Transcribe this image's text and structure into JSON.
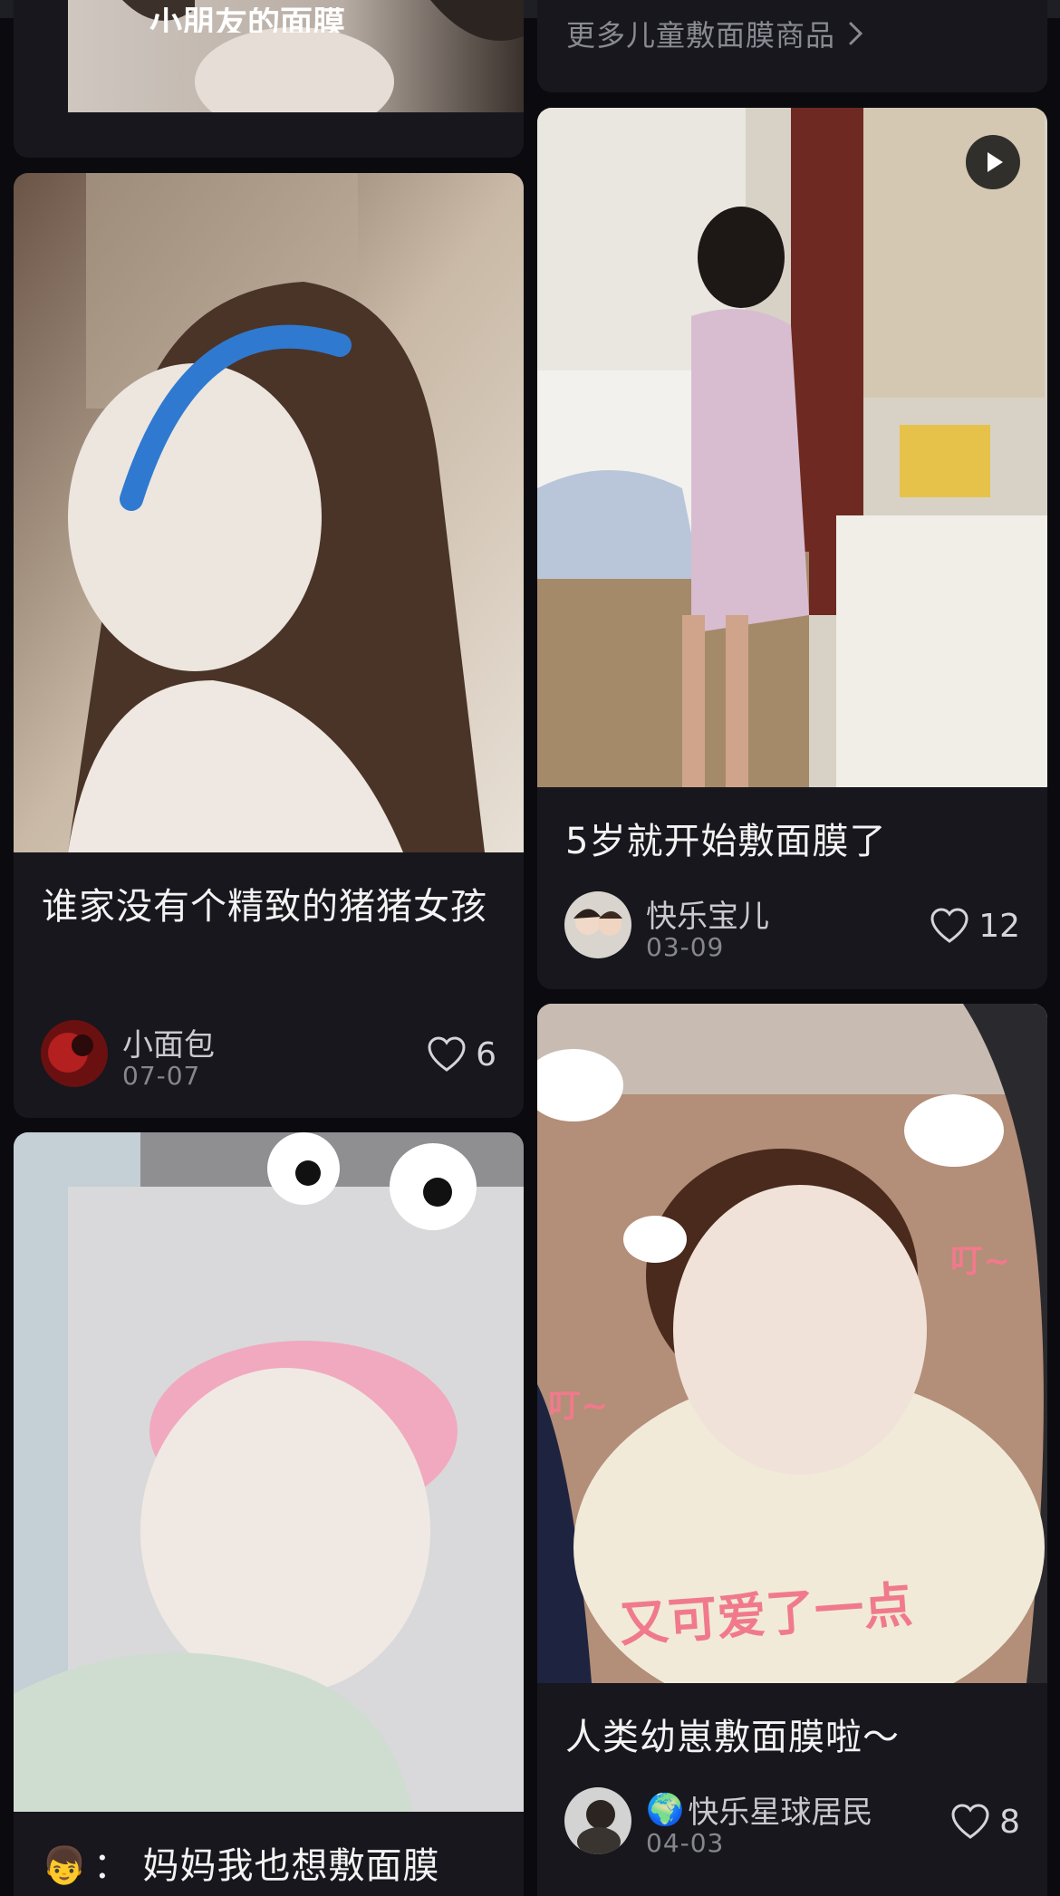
{
  "top_left_card": {
    "image_caption": "小朋友的面膜"
  },
  "top_right_card": {
    "more_link": "更多儿童敷面膜商品",
    "more_chevron": "chevron-right-icon"
  },
  "posts": [
    {
      "title": "谁家没有个精致的猪猪女孩",
      "author": "小面包",
      "date": "07-07",
      "likes": "6"
    },
    {
      "title": "5岁就开始敷面膜了",
      "author": "快乐宝儿",
      "date": "03-09",
      "likes": "12",
      "is_video": true
    },
    {
      "title": "人类幼崽敷面膜啦～",
      "author_emoji": "🌍",
      "author": "快乐星球居民",
      "date": "04-03",
      "likes": "8",
      "stickers": [
        "叮~",
        "叮~",
        "又可爱了一点"
      ]
    },
    {
      "title_emoji": "👦",
      "title": "：  妈妈我也想敷面膜"
    }
  ],
  "icons": {
    "like": "heart-outline-icon",
    "play": "play-icon"
  },
  "colors": {
    "background": "#0b0b0f",
    "card": "#17171d",
    "text_primary": "#f3f3f3",
    "text_secondary": "#c9c9cf",
    "text_muted": "#86868f",
    "sticker_pink": "#f07a8c"
  }
}
